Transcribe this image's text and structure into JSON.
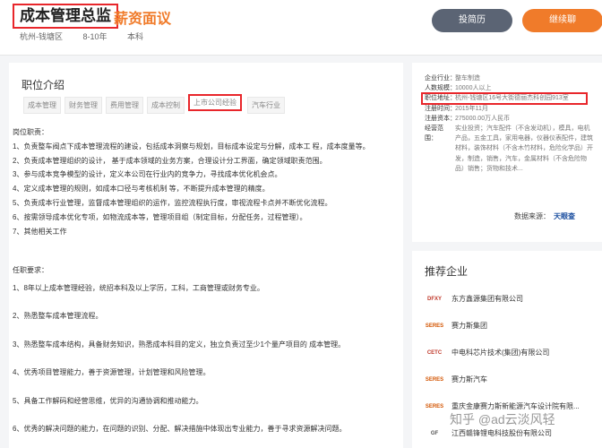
{
  "header": {
    "title": "成本管理总监",
    "salary": "薪资面议",
    "location": "杭州-钱塘区",
    "experience": "8-10年",
    "education": "本科",
    "resume_button": "投简历",
    "chat_button": "继续聊"
  },
  "job": {
    "section_title": "职位介绍",
    "tags": [
      "成本管理",
      "财务管理",
      "费用管理",
      "成本控制",
      "上市公司经验",
      "汽车行业"
    ],
    "duties_title": "岗位职责：",
    "duties": [
      "1、负责整车阀点下成本管理流程的建设，包括成本洞察与规划，目标成本设定与分解，成本工 程，成本度量等。",
      "2、负责成本管理组织的设计， 基于成本领域的业务方案，合理设计分工界面，确定领域职责范围。",
      "3、参与成本竞争模型的设计，定义本公司在行业内的竞争力，寻找成本优化机会点。",
      "4、定义成本管理的规则，如成本口径与考核机制 等，不断提升成本管理的精度。",
      "5、负责成本行业管理，监督成本管理组织的运作，监控流程执行度，审视流程卡点并不断优化流程。",
      "6、按需领导成本优化专项，如物流成本等，管理项目组（制定目标，分配任务，过程管理）。",
      "7、其他相关工作"
    ],
    "req_title": "任职要求：",
    "requirements": [
      "1、8年以上成本管理经验，统招本科及以上学历，工科，工商管理或财务专业。",
      "2、熟悉整车成本管理流程。",
      "3、熟悉整车成本结构，具备财务知识，熟悉成本科目的定义，独立负责过至少1个量产项目的 成本管理。",
      "4、优秀项目管理能力，善于资源管理，计划管理和风险管理。",
      "5、具备工作解码和经营思维，优异的沟通协调和推动能力。",
      "6、优秀的解决问题的能力，在问题的识别、分配、解决措施中体现出专业能力，善于寻求资源解决问题。"
    ]
  },
  "company_info": {
    "rows": [
      {
        "k": "企业行业：",
        "v": "整车制造"
      },
      {
        "k": "人数规模：",
        "v": "10000人以上"
      },
      {
        "k": "职位地址：",
        "v": "杭州-钱塘区16号大街德丽杰科创园913室"
      },
      {
        "k": "注册时间：",
        "v": "2015年11月"
      },
      {
        "k": "注册资本：",
        "v": "275000.00万人民币"
      }
    ],
    "scope_key": "经营范围：",
    "scope": "实业投资；汽车配件（不含发动机），模具，电机产品，五金工具，家用电器，仪器仪表配件，建筑材料，装饰材料（不含木竹材料，危险化学品）开发，制造，销售，汽车，金属材料（不含危险物品）销售；货物和技术...",
    "data_source_label": "数据来源：",
    "data_source": "天眼查"
  },
  "recommend": {
    "title": "推荐企业",
    "companies": [
      {
        "name": "东方鑫源集团有限公司",
        "logo": "DFXY"
      },
      {
        "name": "赛力斯集团",
        "logo": "SERES"
      },
      {
        "name": "中电科芯片技术(集团)有限公司",
        "logo": "CETC"
      },
      {
        "name": "赛力斯汽车",
        "logo": "SERES"
      },
      {
        "name": "重庆金康赛力斯新能源汽车设计院有限...",
        "logo": "SERES"
      },
      {
        "name": "江西赣锋锂电科技股份有限公司",
        "logo": "GF"
      }
    ]
  },
  "watermark": "知乎 @ad云淡风轻",
  "colors": {
    "accent": "#f07b2a",
    "highlight": "#e8262b",
    "brand_blue": "#1c4fa0"
  }
}
